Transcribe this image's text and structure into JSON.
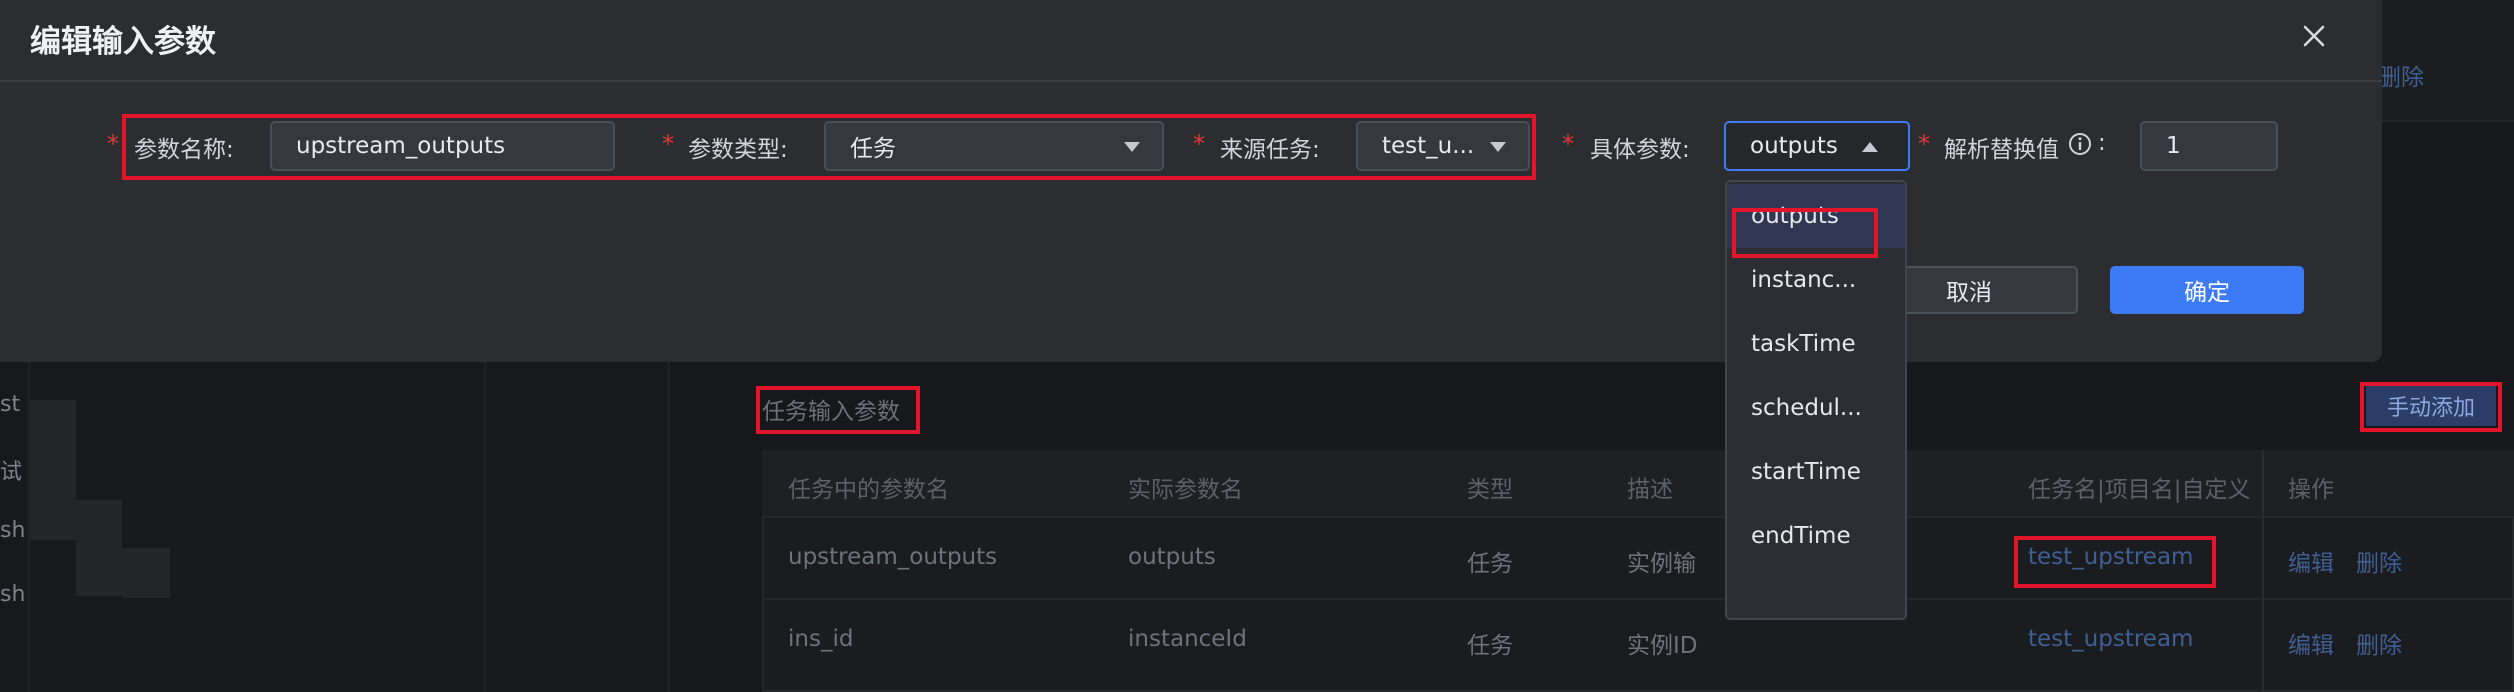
{
  "modal": {
    "title": "编辑输入参数",
    "fields": {
      "param_name": {
        "label": "参数名称:",
        "value": "upstream_outputs"
      },
      "param_type": {
        "label": "参数类型:",
        "value": "任务"
      },
      "source_task": {
        "label": "来源任务:",
        "value": "test_u..."
      },
      "specific_param": {
        "label": "具体参数:",
        "value": "outputs"
      },
      "parse_replace": {
        "label": "解析替换值",
        "suffix": ":",
        "value": "1"
      }
    },
    "required_mark": "*",
    "cancel_label": "取消",
    "ok_label": "确定"
  },
  "dropdown": {
    "options": [
      "outputs",
      "instanc...",
      "taskTime",
      "schedul...",
      "startTime",
      "endTime"
    ],
    "selected": "outputs"
  },
  "background": {
    "left_labels": [
      "st",
      "试",
      "sh",
      "sh"
    ],
    "top_right_link": "删除",
    "section_title": "任务输入参数",
    "manual_add_label": "手动添加",
    "table": {
      "headers": [
        "任务中的参数名",
        "实际参数名",
        "类型",
        "描述",
        "任务名|项目名|自定义",
        "操作"
      ],
      "rows": [
        {
          "param": "upstream_outputs",
          "actual": "outputs",
          "type": "任务",
          "desc": "实例输出",
          "task": "test_upstream",
          "edit": "编辑",
          "delete": "删除"
        },
        {
          "param": "ins_id",
          "actual": "instanceId",
          "type": "任务",
          "desc": "实例ID",
          "task": "test_upstream",
          "edit": "编辑",
          "delete": "删除"
        }
      ]
    }
  },
  "colors": {
    "accent": "#3d7bf6",
    "required": "#e03a3a",
    "annotation": "#e3152a",
    "link": "#3f5f93"
  },
  "icons": [
    "close-icon",
    "caret-down-icon",
    "caret-up-icon",
    "info-circle-icon"
  ]
}
